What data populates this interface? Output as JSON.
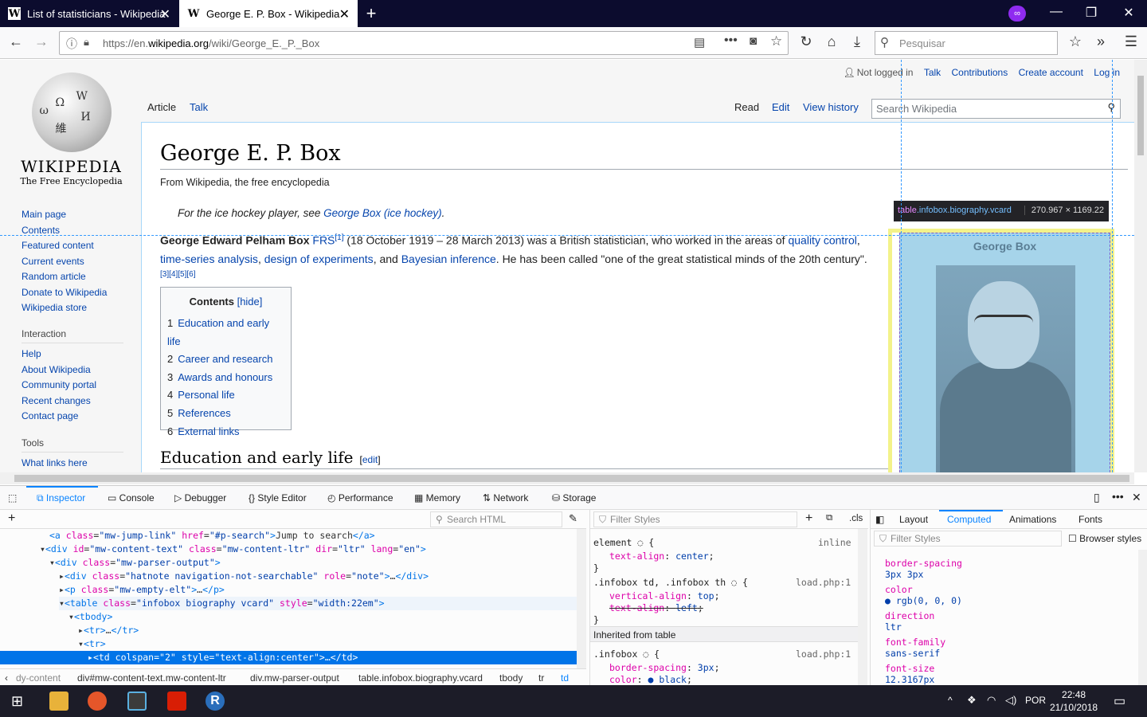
{
  "browser": {
    "tabs": [
      {
        "title": "List of statisticians - Wikipedia",
        "active": false
      },
      {
        "title": "George E. P. Box - Wikipedia",
        "active": true
      }
    ],
    "url_prefix": "https://en.",
    "url_domain": "wikipedia.org",
    "url_path": "/wiki/George_E._P._Box",
    "search_placeholder": "Pesquisar"
  },
  "wiki": {
    "logo_word": "WIKIPEDIA",
    "tagline": "The Free Encyclopedia",
    "nav": [
      "Main page",
      "Contents",
      "Featured content",
      "Current events",
      "Random article",
      "Donate to Wikipedia",
      "Wikipedia store"
    ],
    "interaction_head": "Interaction",
    "interaction": [
      "Help",
      "About Wikipedia",
      "Community portal",
      "Recent changes",
      "Contact page"
    ],
    "tools_head": "Tools",
    "tools": [
      "What links here"
    ],
    "personal": {
      "not_logged": "Not logged in",
      "talk": "Talk",
      "contributions": "Contributions",
      "create": "Create account",
      "login": "Log in"
    },
    "tabs": {
      "article": "Article",
      "talk": "Talk",
      "read": "Read",
      "edit": "Edit",
      "history": "View history"
    },
    "search_placeholder": "Search Wikipedia",
    "title": "George E. P. Box",
    "from": "From Wikipedia, the free encyclopedia",
    "hatnote_prefix": "For the ice hockey player, see ",
    "hatnote_link": "George Box (ice hockey)",
    "hatnote_suffix": ".",
    "lead": {
      "name": "George Edward Pelham Box",
      "frs": "FRS",
      "ref1": "[1]",
      "t1": " (18 October 1919 – 28 March 2013) was a British statistician, who worked in the areas of ",
      "l1": "quality control",
      "t2": ", ",
      "l2": "time-series analysis",
      "t3": ", ",
      "l3": "design of experiments",
      "t4": ", and ",
      "l4": "Bayesian inference",
      "t5": ". He has been called \"one of the great statistical minds of the 20th century\".",
      "refs": "[3][4][5][6]"
    },
    "toc": {
      "title": "Contents",
      "hide": "[hide]",
      "items": [
        {
          "n": "1",
          "label": "Education and early life"
        },
        {
          "n": "2",
          "label": "Career and research"
        },
        {
          "n": "3",
          "label": "Awards and honours"
        },
        {
          "n": "4",
          "label": "Personal life"
        },
        {
          "n": "5",
          "label": "References"
        },
        {
          "n": "6",
          "label": "External links"
        }
      ]
    },
    "h2": "Education and early life",
    "h2_edit": "edit",
    "infobox_caption": "George Box"
  },
  "inspector_tooltip": {
    "tag": "table",
    "classes": ".infobox.biography.vcard",
    "dims": "270.967 × 1169.22"
  },
  "devtools": {
    "tabs": [
      "Inspector",
      "Console",
      "Debugger",
      "Style Editor",
      "Performance",
      "Memory",
      "Network",
      "Storage"
    ],
    "search_html": "Search HTML",
    "markup": [
      {
        "indent": 0,
        "text": "<a class=\"mw-jump-link\" href=\"#p-search\">Jump to search</a>"
      },
      {
        "indent": 1,
        "text": "▾<div id=\"mw-content-text\" class=\"mw-content-ltr\" dir=\"ltr\" lang=\"en\">"
      },
      {
        "indent": 2,
        "text": "▾<div class=\"mw-parser-output\">"
      },
      {
        "indent": 3,
        "text": "▸<div class=\"hatnote navigation-not-searchable\" role=\"note\">…</div>"
      },
      {
        "indent": 3,
        "text": "▸<p class=\"mw-empty-elt\">…</p>"
      },
      {
        "indent": 3,
        "text": "▾<table class=\"infobox biography vcard\" style=\"width:22em\">"
      },
      {
        "indent": 4,
        "text": "▾<tbody>"
      },
      {
        "indent": 5,
        "text": "▸<tr>…</tr>"
      },
      {
        "indent": 5,
        "text": "▾<tr>"
      },
      {
        "indent": 6,
        "text": "▸<td colspan=\"2\" style=\"text-align:center\">…</td>",
        "selected": true
      }
    ],
    "breadcrumbs": [
      "dy-content",
      "div#mw-content-text.mw-content-ltr",
      "div.mw-parser-output",
      "table.infobox.biography.vcard",
      "tbody",
      "tr",
      "td"
    ],
    "filter_styles": "Filter Styles",
    "cls": ".cls",
    "rules": {
      "element": "element",
      "inline": "inline",
      "r1_prop": "text-align",
      "r1_val": "center",
      "r2_sel": ".infobox td, .infobox th",
      "r2_src": "load.php:1",
      "r2_p1": "vertical-align",
      "r2_v1": "top",
      "r2_p2": "text-align",
      "r2_v2": "left",
      "inherited": "Inherited from table",
      "r3_sel": ".infobox",
      "r3_src": "load.php:1",
      "r3_p1": "border-spacing",
      "r3_v1": "3px",
      "r3_p2": "color",
      "r3_v2": "black"
    },
    "computed_tabs": [
      "Layout",
      "Computed",
      "Animations",
      "Fonts"
    ],
    "computed_filter": "Filter Styles",
    "browser_styles": "Browser styles",
    "computed": [
      {
        "prop": "border-spacing",
        "val": "3px 3px"
      },
      {
        "prop": "color",
        "val": "rgb(0, 0, 0)"
      },
      {
        "prop": "direction",
        "val": "ltr"
      },
      {
        "prop": "font-family",
        "val": "sans-serif"
      },
      {
        "prop": "font-size",
        "val": "12.3167px"
      }
    ]
  },
  "taskbar": {
    "lang": "POR",
    "time": "22:48",
    "date": "21/10/2018"
  },
  "colors": {
    "link": "#0645ad",
    "accent": "#0a84ff",
    "titlebar": "#0c0c2e"
  }
}
